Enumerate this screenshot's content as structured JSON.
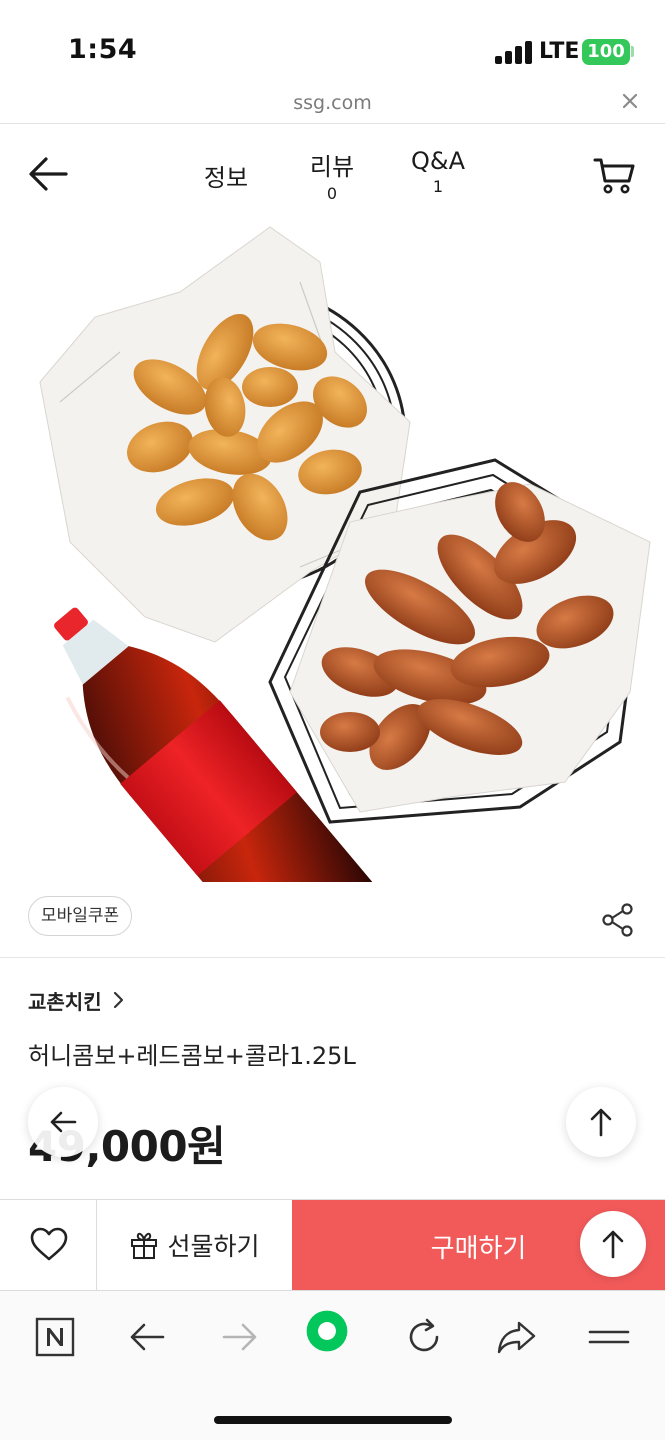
{
  "status_bar": {
    "time": "1:54",
    "network": "LTE",
    "battery": "100"
  },
  "browser": {
    "url": "ssg.com"
  },
  "nav": {
    "tabs": [
      {
        "label": "정보"
      },
      {
        "label": "리뷰",
        "count": "0"
      },
      {
        "label": "Q&A",
        "count": "1"
      }
    ]
  },
  "product": {
    "coupon_badge": "모바일쿠폰",
    "brand": "교촌치킨",
    "name": "허니콤보+레드콤보+콜라1.25L",
    "price": "49,000원"
  },
  "purchase_bar": {
    "gift_label": "선물하기",
    "buy_label": "구매하기"
  },
  "colors": {
    "buy_button": "#f25a5a",
    "battery": "#34c759",
    "naver_green": "#03c75a"
  },
  "icons": [
    "back-arrow-icon",
    "cart-icon",
    "share-icon",
    "chevron-right-icon",
    "heart-icon",
    "gift-icon",
    "arrow-up-icon",
    "naver-icon",
    "refresh-icon",
    "share-forward-icon",
    "menu-icon"
  ]
}
